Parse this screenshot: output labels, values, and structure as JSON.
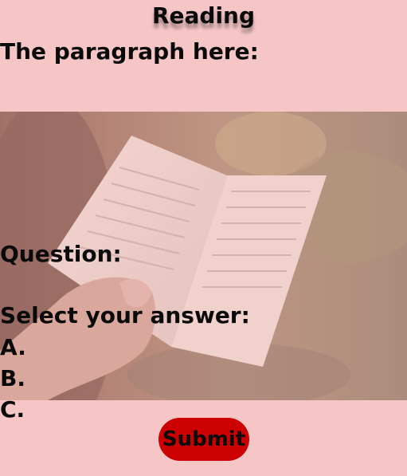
{
  "header": {
    "title": "Reading"
  },
  "paragraph": {
    "label": "The paragraph here:"
  },
  "question": {
    "label": "Question:"
  },
  "answer": {
    "prompt": "Select your answer:",
    "options": [
      "A.",
      "B.",
      "C."
    ]
  },
  "actions": {
    "submit_label": "Submit"
  },
  "colors": {
    "background": "#f6c6c7",
    "submit_button": "#cc0000",
    "text": "#0a0a0a"
  },
  "image": {
    "subject": "hand holding open book outdoors"
  }
}
